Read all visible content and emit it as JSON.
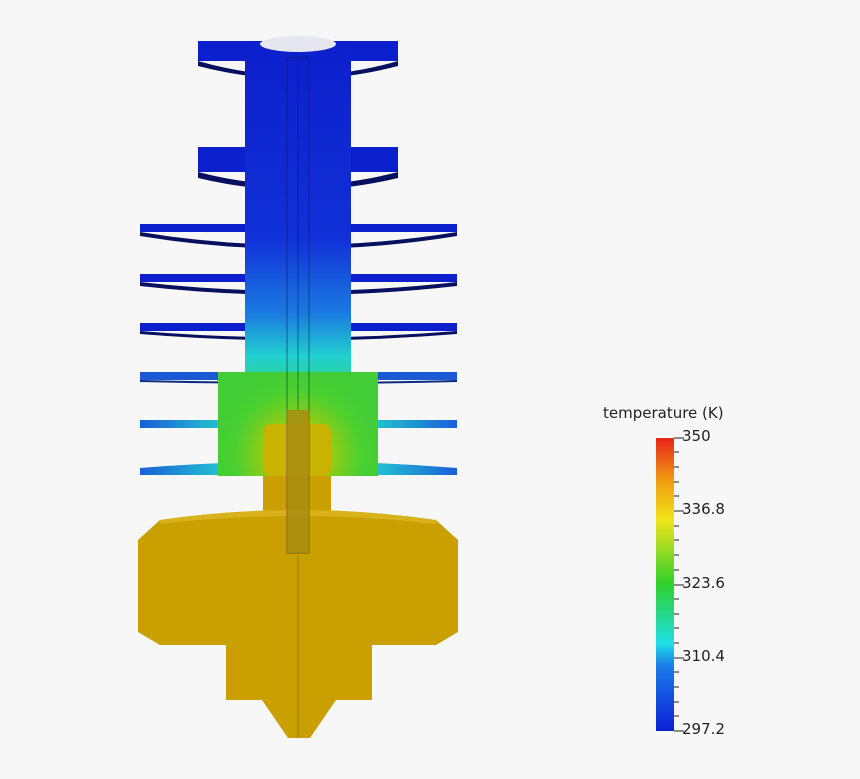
{
  "colorbar": {
    "title": "temperature (K)",
    "ticks": [
      "350",
      "336.8",
      "323.6",
      "310.4",
      "297.2"
    ],
    "colors": {
      "max": "#e8241b",
      "upper": "#f0e41a",
      "mid": "#2fd02c",
      "lower": "#1fe0e6",
      "min": "#0c1fd6"
    }
  },
  "model_colors": {
    "cold": "#0c1fcc",
    "cold_shadow": "#07105e",
    "mid": "#20c8c8",
    "warm": "#3cc828",
    "hot": "#c9a000",
    "hot_edge": "#d8b21a"
  }
}
